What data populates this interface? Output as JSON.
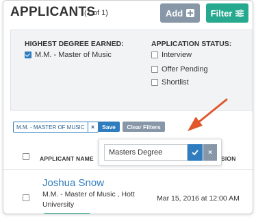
{
  "header": {
    "title": "APPLICANTS",
    "count": "(1 of 1)",
    "add_label": "Add",
    "filter_label": "Filter"
  },
  "filters": {
    "degree": {
      "title": "HIGHEST DEGREE EARNED:",
      "options": [
        {
          "label": "M.M. - Master of Music",
          "checked": true
        }
      ]
    },
    "status": {
      "title": "APPLICATION STATUS:",
      "options": [
        {
          "label": "Interview",
          "checked": false
        },
        {
          "label": "Offer Pending",
          "checked": false
        },
        {
          "label": "Shortlist",
          "checked": false
        }
      ]
    }
  },
  "active_filters": {
    "chip_label": "M.M. - MASTER OF MUSIC",
    "chip_remove": "×",
    "save_label": "Save",
    "clear_label": "Clear Filters"
  },
  "save_popover": {
    "input_value": "Masters Degree",
    "cancel_glyph": "×"
  },
  "table": {
    "columns": {
      "name": "APPLICANT NAME",
      "submission_fragment": "SION"
    },
    "rows": [
      {
        "name": "Joshua Snow",
        "degree": "M.M. - Master of Music , Hott University",
        "date": "Mar 15, 2016 at 12:00 AM"
      }
    ]
  },
  "colors": {
    "accent_green": "#26a98e",
    "accent_blue": "#2f7dbf",
    "muted_gray": "#8797a8",
    "arrow_orange": "#e0572b"
  },
  "icons": {
    "add": "plus-square-icon",
    "filter": "sliders-icon",
    "confirm": "checkmark-icon",
    "cancel": "close-icon"
  }
}
